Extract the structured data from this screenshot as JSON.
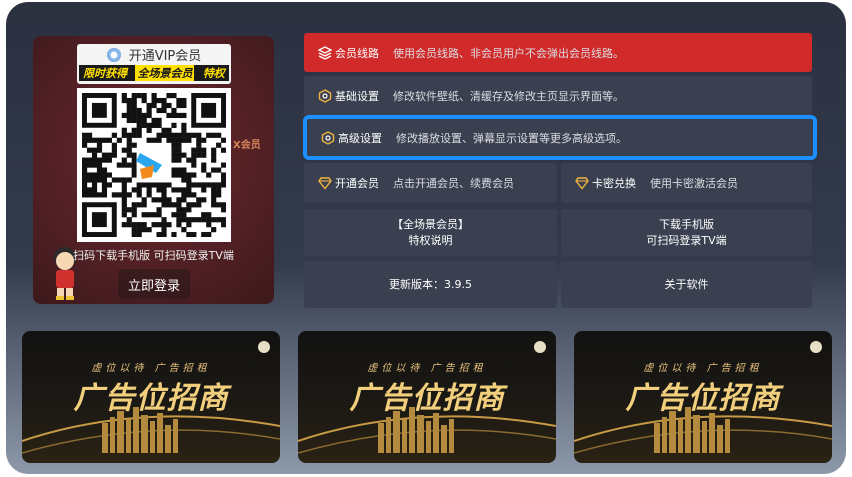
{
  "vip": {
    "card_title": "开通VIP会员",
    "card_tags": [
      "限时获得",
      "全场景会员",
      "特权"
    ],
    "side_text": "X会员",
    "caption": "扫码下载手机版 可扫码登录TV端",
    "login_label": "立即登录"
  },
  "menu": [
    {
      "icon": "layers-icon",
      "title": "会员线路",
      "desc": "使用会员线路、非会员用户不会弹出会员线路。"
    },
    {
      "icon": "hexagon-icon",
      "title": "基础设置",
      "desc": "修改软件壁纸、清缓存及修改主页显示界面等。"
    },
    {
      "icon": "hexagon-icon",
      "title": "高级设置",
      "desc": "修改播放设置、弹幕显示设置等更多高级选项。"
    }
  ],
  "actions": {
    "open_vip": {
      "icon": "diamond-icon",
      "title": "开通会员",
      "desc": "点击开通会员、续费会员"
    },
    "redeem": {
      "icon": "diamond-icon",
      "title": "卡密兑换",
      "desc": "使用卡密激活会员"
    }
  },
  "buttons": {
    "privilege_line1": "【全场景会员】",
    "privilege_line2": "特权说明",
    "download_line1": "下载手机版",
    "download_line2": "可扫码登录TV端",
    "version_label": "更新版本：",
    "version_value": "3.9.5",
    "about": "关于软件"
  },
  "banners": [
    {
      "small": "虚位以待 广告招租",
      "big": "广告位招商"
    },
    {
      "small": "虚位以待 广告招租",
      "big": "广告位招商"
    },
    {
      "small": "虚位以待 广告招租",
      "big": "广告位招商"
    }
  ],
  "colors": {
    "accent_red": "#d02a2a",
    "focus_blue": "#1e8fff",
    "row_bg": "#3a4050",
    "gold": "#f2cf7c"
  }
}
